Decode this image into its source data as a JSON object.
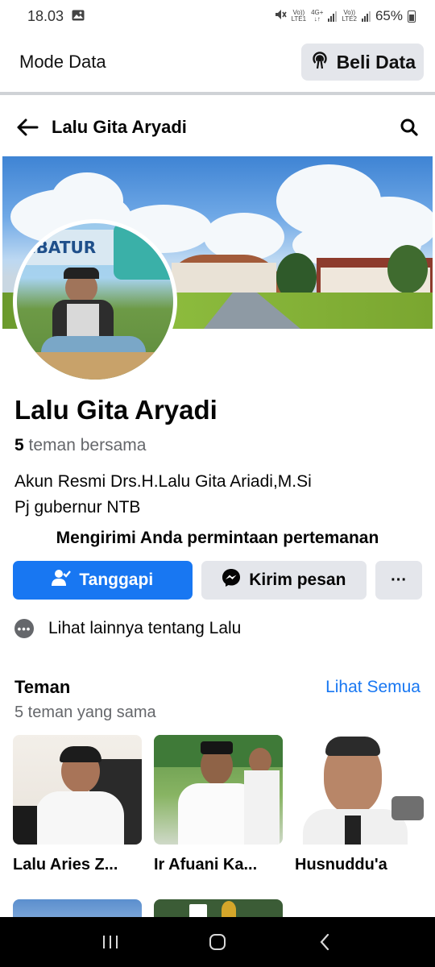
{
  "status_bar": {
    "time": "18.03",
    "net1_top": "Vo))",
    "net1_bottom": "LTE1",
    "net_type": "4G+",
    "net2_top": "Vo))",
    "net2_bottom": "LTE2",
    "battery": "65%"
  },
  "data_bar": {
    "mode_label": "Mode Data",
    "buy_label": "Beli Data"
  },
  "header": {
    "title": "Lalu Gita Aryadi"
  },
  "cover": {
    "banner_text": "EBATUR"
  },
  "profile": {
    "name": "Lalu Gita Aryadi",
    "mutual_count": "5",
    "mutual_label": "teman bersama",
    "bio_line1": "Akun Resmi Drs.H.Lalu Gita Ariadi,M.Si",
    "bio_line2": "Pj gubernur NTB",
    "request_text": "Mengirimi Anda permintaan pertemanan"
  },
  "actions": {
    "respond": "Tanggapi",
    "message": "Kirim pesan",
    "more": "···"
  },
  "more_about": {
    "label": "Lihat lainnya tentang Lalu"
  },
  "friends": {
    "title": "Teman",
    "see_all": "Lihat Semua",
    "subtitle": "5 teman yang sama",
    "items": [
      {
        "name": "Lalu Aries Z..."
      },
      {
        "name": "Ir Afuani Ka..."
      },
      {
        "name": "Husnuddu'a"
      }
    ]
  },
  "colors": {
    "primary": "#1877f2",
    "secondary_bg": "#e4e6eb",
    "muted_text": "#65676b"
  }
}
